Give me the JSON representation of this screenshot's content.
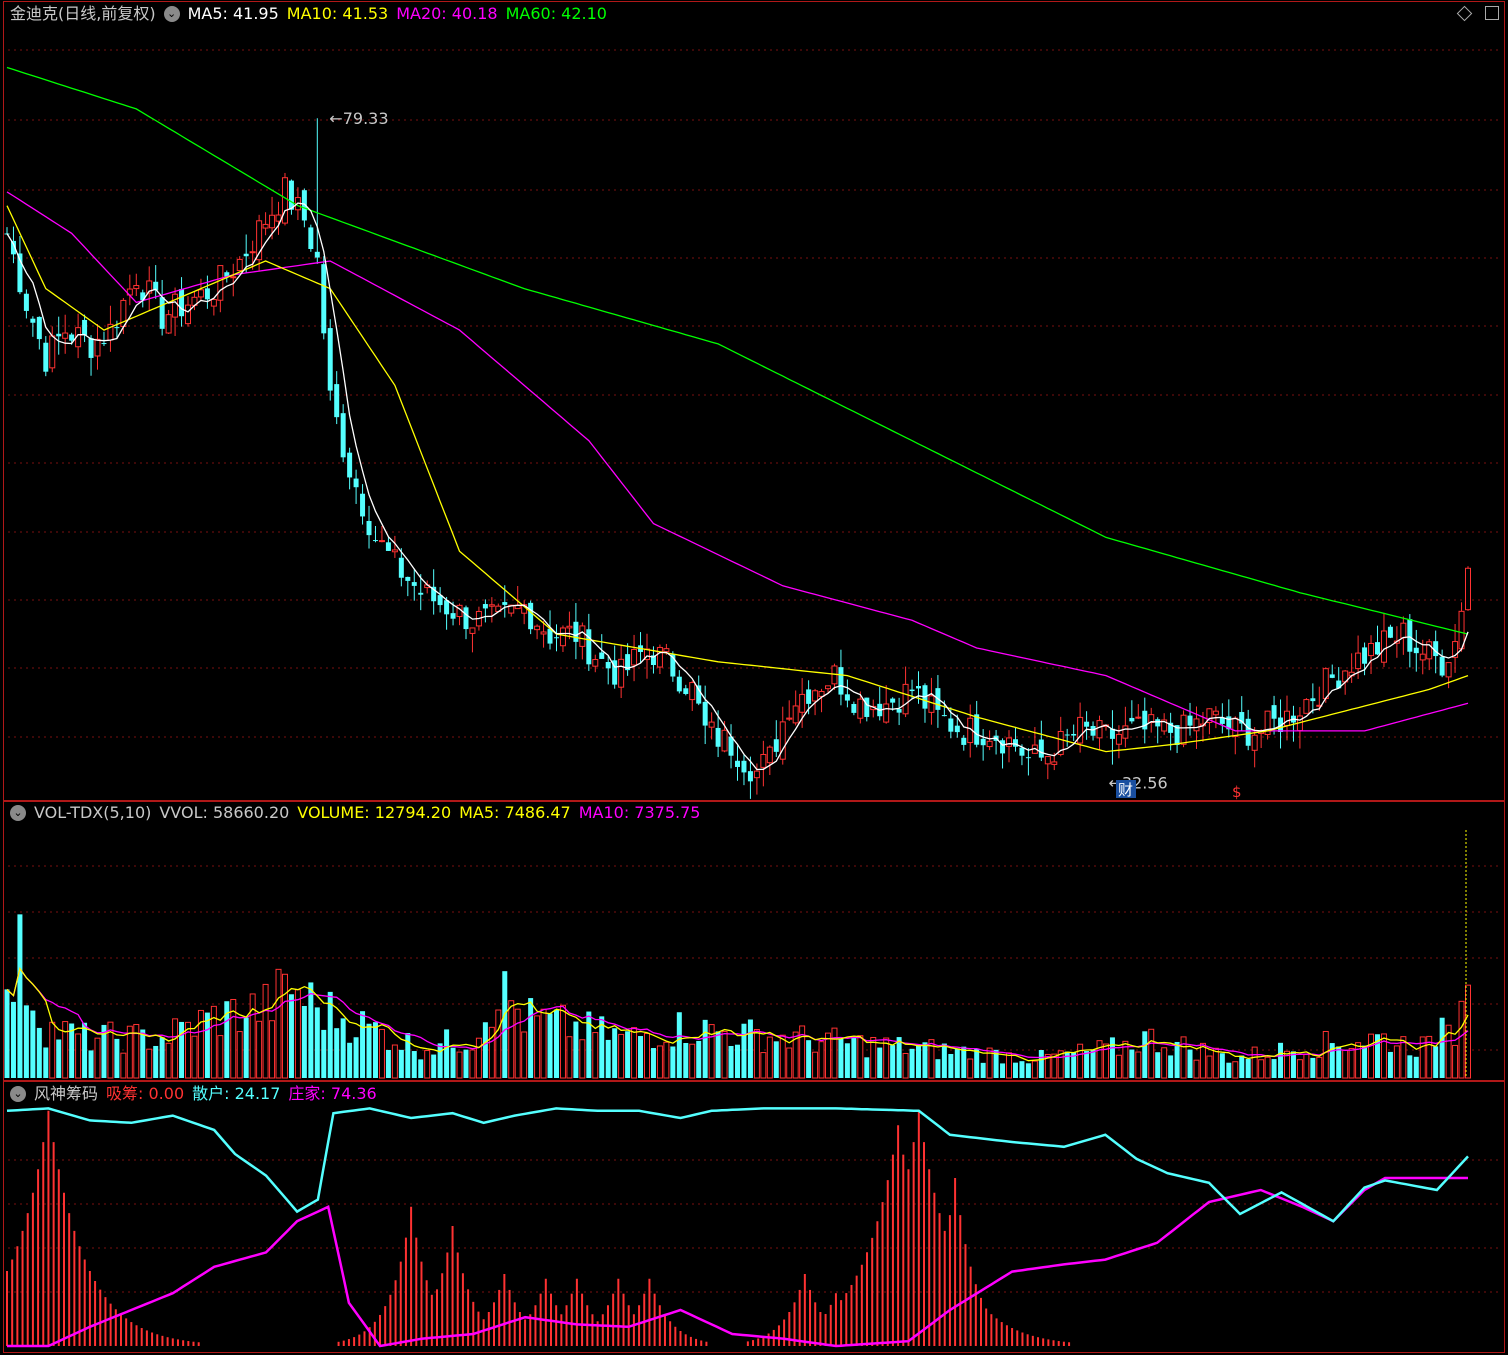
{
  "colors": {
    "up": "#ff3232",
    "down": "#54ffff",
    "ma5": "#ffffff",
    "ma10": "#ffff00",
    "ma20": "#ff00ff",
    "ma60": "#00ff00",
    "grid": "#7a1010",
    "border": "#b01818",
    "text_default": "#c8c8c8"
  },
  "main": {
    "title": "金迪克(日线,前复权)",
    "ma_items": [
      {
        "label": "MA5: 41.95",
        "color": "#ffffff"
      },
      {
        "label": "MA10: 41.53",
        "color": "#ffff00"
      },
      {
        "label": "MA20: 40.18",
        "color": "#ff00ff"
      },
      {
        "label": "MA60: 42.10",
        "color": "#00ff00"
      }
    ],
    "high_label": "79.33",
    "low_label": "32.56",
    "marker_cai": "财",
    "marker_s": "$"
  },
  "vol": {
    "title": "VOL-TDX(5,10)",
    "items": [
      {
        "label": "VVOL: 58660.20",
        "color": "#c8c8c8"
      },
      {
        "label": "VOLUME: 12794.20",
        "color": "#ffff00"
      },
      {
        "label": "MA5: 7486.47",
        "color": "#ffff00"
      },
      {
        "label": "MA10: 7375.75",
        "color": "#ff00ff"
      }
    ]
  },
  "ind": {
    "title": "风神筹码",
    "items": [
      {
        "label": "吸筹: 0.00",
        "color": "#ff3232",
        "key": "吸筹"
      },
      {
        "label": "散户: 24.17",
        "color": "#54ffff",
        "key": "散户"
      },
      {
        "label": "庄家: 74.36",
        "color": "#ff00ff",
        "key": "庄家"
      }
    ]
  },
  "chart_data": [
    {
      "type": "candlestick",
      "name": "price",
      "y_range": [
        30,
        86
      ],
      "high": 79.33,
      "low": 32.56,
      "close_anchors": [
        [
          0,
          71
        ],
        [
          3,
          66
        ],
        [
          6,
          62
        ],
        [
          9,
          64
        ],
        [
          13,
          63
        ],
        [
          16,
          64
        ],
        [
          20,
          68
        ],
        [
          24,
          65
        ],
        [
          28,
          66
        ],
        [
          32,
          67
        ],
        [
          36,
          69
        ],
        [
          40,
          72
        ],
        [
          43,
          74
        ],
        [
          46,
          72
        ],
        [
          48,
          69
        ],
        [
          50,
          59
        ],
        [
          53,
          54
        ],
        [
          57,
          49
        ],
        [
          60,
          47
        ],
        [
          64,
          45
        ],
        [
          68,
          44
        ],
        [
          72,
          43
        ],
        [
          76,
          43
        ],
        [
          80,
          44
        ],
        [
          84,
          42
        ],
        [
          88,
          42
        ],
        [
          92,
          40
        ],
        [
          95,
          39
        ],
        [
          99,
          41
        ],
        [
          102,
          40
        ],
        [
          106,
          38
        ],
        [
          108,
          35
        ],
        [
          112,
          34
        ],
        [
          116,
          32
        ],
        [
          118,
          33
        ],
        [
          121,
          37
        ],
        [
          124,
          38
        ],
        [
          128,
          39
        ],
        [
          132,
          37
        ],
        [
          136,
          37
        ],
        [
          140,
          38
        ],
        [
          144,
          36
        ],
        [
          148,
          35
        ],
        [
          152,
          35
        ],
        [
          156,
          34
        ],
        [
          158,
          33
        ],
        [
          160,
          33
        ],
        [
          163,
          34
        ],
        [
          166,
          35
        ],
        [
          170,
          34.5
        ],
        [
          174,
          35
        ],
        [
          178,
          35
        ],
        [
          182,
          35
        ],
        [
          186,
          36
        ],
        [
          190,
          35
        ],
        [
          194,
          35
        ],
        [
          198,
          36
        ],
        [
          203,
          38
        ],
        [
          208,
          40
        ],
        [
          212,
          41
        ],
        [
          216,
          42
        ],
        [
          218,
          41
        ],
        [
          222,
          40
        ],
        [
          224,
          41.5
        ],
        [
          226,
          47
        ]
      ],
      "ma60_anchors": [
        [
          0,
          83
        ],
        [
          20,
          80
        ],
        [
          45,
          73
        ],
        [
          80,
          67
        ],
        [
          110,
          63
        ],
        [
          140,
          56
        ],
        [
          170,
          49
        ],
        [
          200,
          45
        ],
        [
          226,
          42
        ]
      ],
      "ma20_anchors": [
        [
          0,
          74
        ],
        [
          10,
          71
        ],
        [
          20,
          66
        ],
        [
          35,
          68
        ],
        [
          50,
          69
        ],
        [
          70,
          64
        ],
        [
          90,
          56
        ],
        [
          100,
          50
        ],
        [
          120,
          45.5
        ],
        [
          140,
          43
        ],
        [
          150,
          41
        ],
        [
          170,
          39
        ],
        [
          180,
          37
        ],
        [
          190,
          35
        ],
        [
          210,
          35
        ],
        [
          226,
          37
        ]
      ],
      "ma10_anchors": [
        [
          0,
          73
        ],
        [
          6,
          67
        ],
        [
          15,
          64
        ],
        [
          25,
          66
        ],
        [
          40,
          69
        ],
        [
          50,
          67
        ],
        [
          60,
          60
        ],
        [
          70,
          48
        ],
        [
          85,
          42
        ],
        [
          110,
          40
        ],
        [
          130,
          39
        ],
        [
          150,
          36
        ],
        [
          170,
          33.5
        ],
        [
          180,
          34
        ],
        [
          195,
          35
        ],
        [
          220,
          38
        ],
        [
          226,
          39
        ]
      ],
      "volume_anchors": [
        [
          0,
          7
        ],
        [
          2,
          12
        ],
        [
          4,
          8
        ],
        [
          6,
          5
        ],
        [
          12,
          4
        ],
        [
          24,
          4
        ],
        [
          32,
          6
        ],
        [
          40,
          7
        ],
        [
          44,
          9
        ],
        [
          48,
          7
        ],
        [
          56,
          5
        ],
        [
          64,
          3
        ],
        [
          72,
          4
        ],
        [
          76,
          9
        ],
        [
          80,
          6
        ],
        [
          96,
          4
        ],
        [
          104,
          5
        ],
        [
          120,
          4
        ],
        [
          140,
          3
        ],
        [
          160,
          2
        ],
        [
          172,
          3
        ],
        [
          176,
          4
        ],
        [
          190,
          2
        ],
        [
          200,
          3
        ],
        [
          212,
          4
        ],
        [
          220,
          3
        ],
        [
          223,
          7
        ],
        [
          224,
          5
        ],
        [
          225,
          10
        ],
        [
          226,
          12.8
        ]
      ],
      "volume_range": [
        0,
        25
      ]
    },
    {
      "type": "line+bar",
      "name": "风神筹码",
      "y_range": [
        0,
        100
      ],
      "series": [
        {
          "name": "散户",
          "anchors": [
            [
              0,
              98
            ],
            [
              8,
              99
            ],
            [
              16,
              94
            ],
            [
              24,
              93
            ],
            [
              32,
              96
            ],
            [
              40,
              90
            ],
            [
              44,
              80
            ],
            [
              50,
              71
            ],
            [
              56,
              56
            ],
            [
              60,
              61
            ],
            [
              63,
              97
            ],
            [
              70,
              99
            ],
            [
              78,
              95
            ],
            [
              86,
              97
            ],
            [
              92,
              93
            ],
            [
              98,
              96
            ],
            [
              106,
              99
            ],
            [
              114,
              98
            ],
            [
              122,
              98
            ],
            [
              130,
              95
            ],
            [
              136,
              98
            ],
            [
              146,
              99
            ],
            [
              160,
              99
            ],
            [
              176,
              98
            ],
            [
              182,
              88
            ],
            [
              194,
              85
            ],
            [
              204,
              83
            ],
            [
              212,
              88
            ],
            [
              218,
              78
            ],
            [
              224,
              72
            ],
            [
              232,
              68
            ],
            [
              238,
              55
            ],
            [
              246,
              64
            ],
            [
              256,
              52
            ],
            [
              262,
              66
            ],
            [
              266,
              69
            ],
            [
              276,
              65
            ],
            [
              282,
              79
            ]
          ]
        },
        {
          "name": "庄家",
          "anchors": [
            [
              0,
              0
            ],
            [
              8,
              0
            ],
            [
              16,
              8
            ],
            [
              24,
              15
            ],
            [
              32,
              22
            ],
            [
              40,
              33
            ],
            [
              50,
              39
            ],
            [
              56,
              52
            ],
            [
              62,
              58
            ],
            [
              66,
              18
            ],
            [
              72,
              0
            ],
            [
              80,
              3
            ],
            [
              90,
              5
            ],
            [
              100,
              12
            ],
            [
              110,
              9
            ],
            [
              120,
              8
            ],
            [
              130,
              15
            ],
            [
              140,
              5
            ],
            [
              150,
              3
            ],
            [
              160,
              0
            ],
            [
              174,
              2
            ],
            [
              182,
              15
            ],
            [
              194,
              31
            ],
            [
              204,
              34
            ],
            [
              212,
              36
            ],
            [
              222,
              43
            ],
            [
              232,
              60
            ],
            [
              242,
              65
            ],
            [
              250,
              58
            ],
            [
              256,
              52
            ],
            [
              262,
              65
            ],
            [
              266,
              70
            ]
          ]
        },
        {
          "name": "吸筹",
          "peaks": [
            [
              8,
              98
            ],
            [
              78,
              58
            ],
            [
              86,
              50
            ],
            [
              96,
              30
            ],
            [
              104,
              28
            ],
            [
              110,
              28
            ],
            [
              118,
              28
            ],
            [
              124,
              28
            ],
            [
              154,
              30
            ],
            [
              160,
              22
            ],
            [
              172,
              92
            ],
            [
              176,
              98
            ],
            [
              183,
              70
            ]
          ]
        }
      ]
    }
  ]
}
